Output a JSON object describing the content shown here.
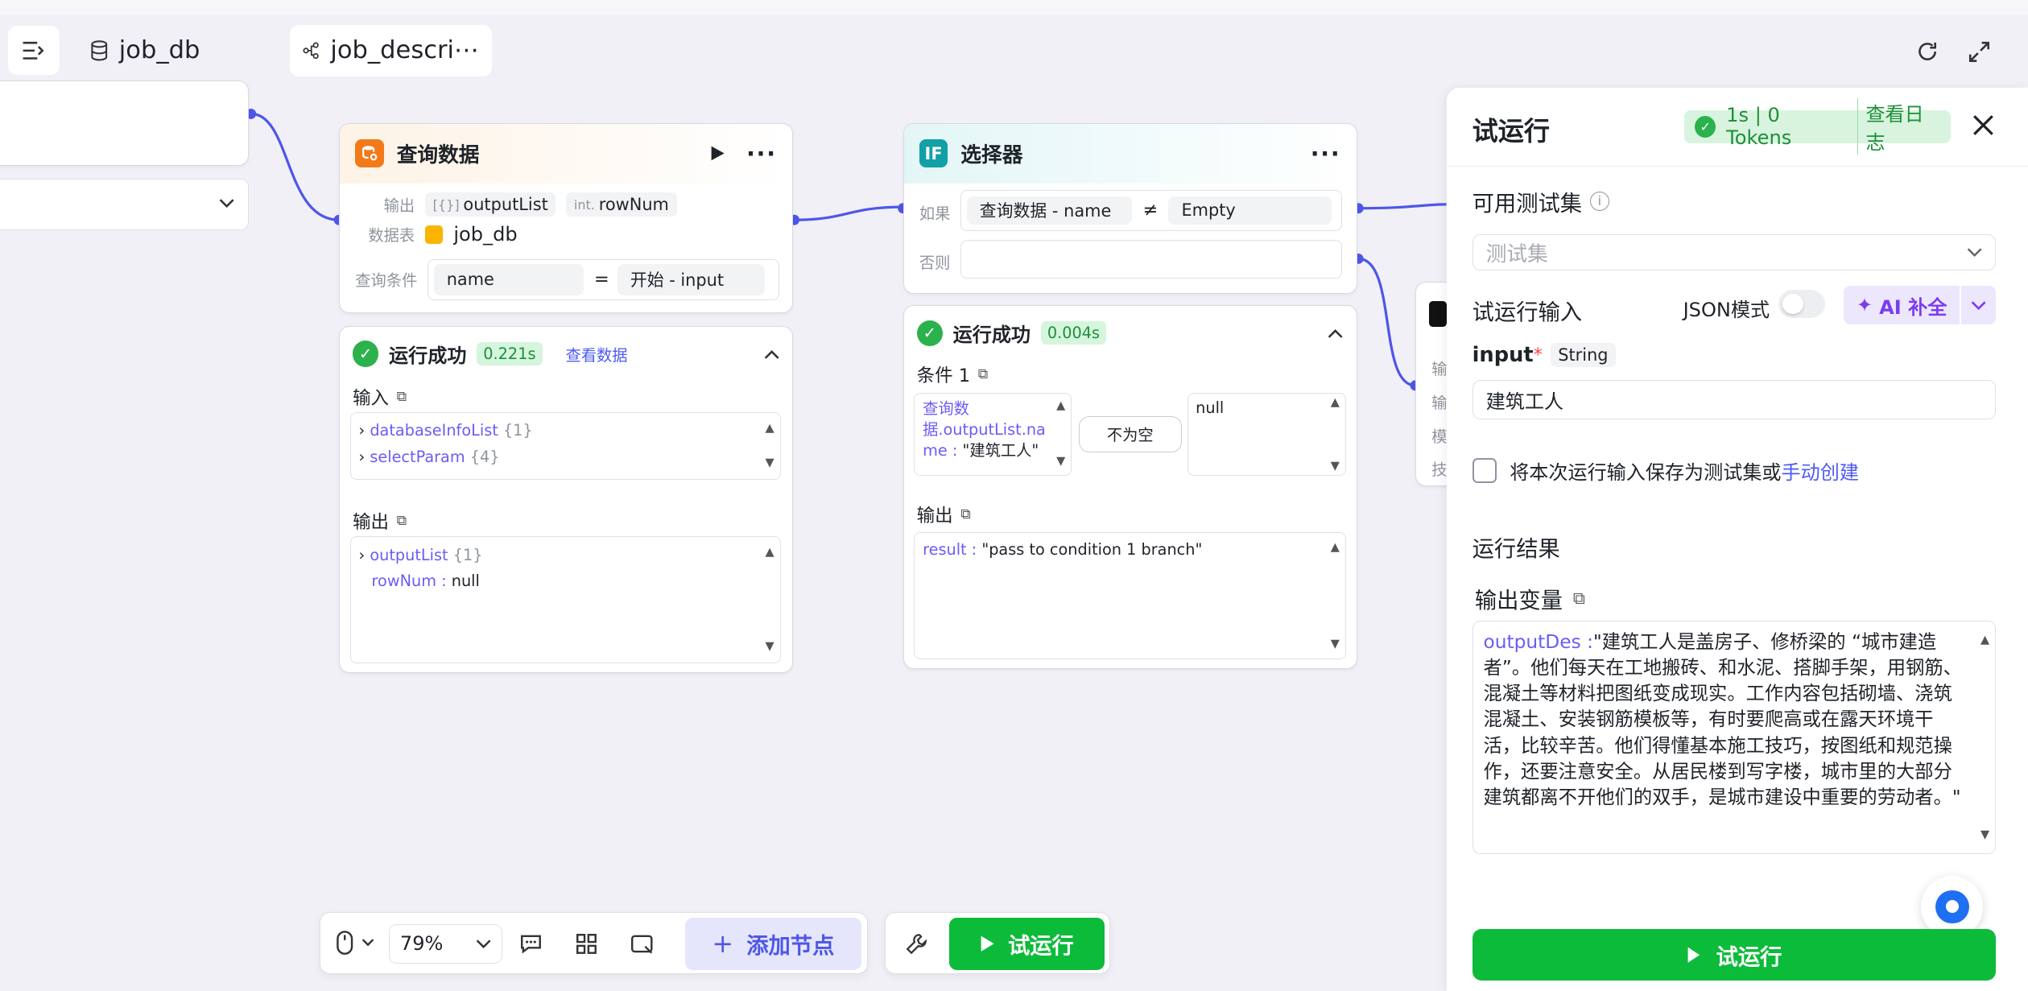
{
  "tabs": {
    "db": "job_db",
    "workflow": "job_descri⋯"
  },
  "query_node": {
    "title": "查询数据",
    "output_label": "输出",
    "out_chip1_type": "[{}]",
    "out_chip1": "outputList",
    "out_chip2_type": "int.",
    "out_chip2": "rowNum",
    "table_label": "数据表",
    "table_name": "job_db",
    "cond_label": "查询条件",
    "cond_left": "name",
    "cond_op": "=",
    "cond_right": "开始  -  input"
  },
  "query_result": {
    "status": "运行成功",
    "time": "0.221s",
    "view": "查看数据",
    "input_label": "输入",
    "in_rows": [
      {
        "k": "databaseInfoList",
        "c": "{1}"
      },
      {
        "k": "selectParam",
        "c": "{4}"
      }
    ],
    "output_label": "输出",
    "out_row1_k": "outputList",
    "out_row1_c": "{1}",
    "out_row2_k": "rowNum",
    "out_row2_v": "null"
  },
  "selector_node": {
    "title": "选择器",
    "if_label": "如果",
    "if_left": "查询数据  -  name",
    "if_op": "≠",
    "if_right": "Empty",
    "else_label": "否则"
  },
  "selector_result": {
    "status": "运行成功",
    "time": "0.004s",
    "cond_label": "条件 1",
    "cond_text_l1": "查询数",
    "cond_text_l2": "据.outputList.na",
    "cond_text_l3_k": "me :",
    "cond_text_l3_v": "\"建筑工人\"",
    "cond_op": "不为空",
    "cond_value": "null",
    "output_label": "输出",
    "result_k": "result :",
    "result_v": "\"pass to condition 1 branch\""
  },
  "right_node": {
    "rows": [
      "输",
      "输",
      "模",
      "技"
    ]
  },
  "panel": {
    "title": "试运行",
    "stat": "1s | 0 Tokens",
    "view_log": "查看日志",
    "testset_label": "可用测试集",
    "testset_placeholder": "测试集",
    "input_section": "试运行输入",
    "json_mode": "JSON模式",
    "ai_fill": "AI 补全",
    "input_name": "input",
    "input_type": "String",
    "input_value": "建筑工人",
    "save_text": "将本次运行输入保存为测试集或",
    "save_link": "手动创建",
    "result_section": "运行结果",
    "output_var": "输出变量",
    "output_key": "outputDes :",
    "output_value": "\"建筑工人是盖房子、修桥梁的 “城市建造者”。他们每天在工地搬砖、和水泥、搭脚手架，用钢筋、混凝土等材料把图纸变成现实。工作内容包括砌墙、浇筑混凝土、安装钢筋模板等，有时要爬高或在露天环境干活，比较辛苦。他们得懂基本施工技巧，按图纸和规范操作，还要注意安全。从居民楼到写字楼，城市里的大部分建筑都离不开他们的双手，是城市建设中重要的劳动者。\"",
    "run_button": "试运行"
  },
  "toolbar": {
    "zoom": "79%",
    "add_node": "添加节点",
    "run": "试运行"
  }
}
